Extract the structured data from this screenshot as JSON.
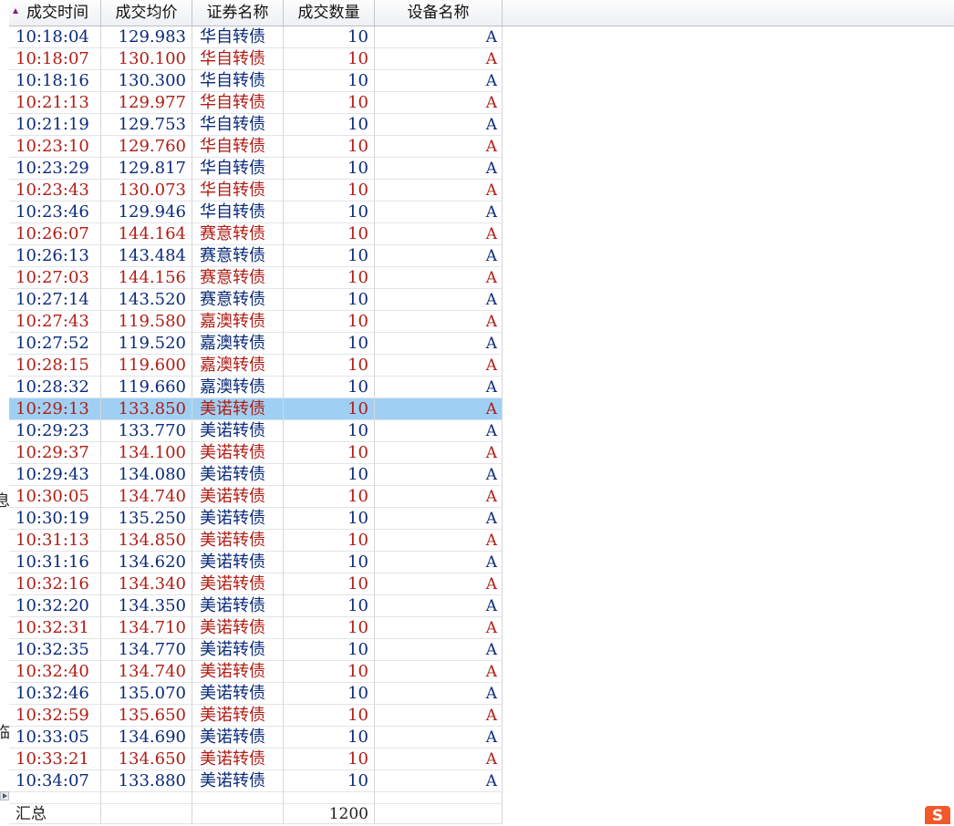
{
  "left_chars": [
    "息",
    "临"
  ],
  "columns": [
    "成交时间",
    "成交均价",
    "证券名称",
    "成交数量",
    "设备名称"
  ],
  "rows": [
    {
      "time": "10:18:04",
      "price": "129.983",
      "name": "华自转债",
      "qty": "10",
      "device": "A",
      "color": "blue"
    },
    {
      "time": "10:18:07",
      "price": "130.100",
      "name": "华自转债",
      "qty": "10",
      "device": "A",
      "color": "red"
    },
    {
      "time": "10:18:16",
      "price": "130.300",
      "name": "华自转债",
      "qty": "10",
      "device": "A",
      "color": "blue"
    },
    {
      "time": "10:21:13",
      "price": "129.977",
      "name": "华自转债",
      "qty": "10",
      "device": "A",
      "color": "red"
    },
    {
      "time": "10:21:19",
      "price": "129.753",
      "name": "华自转债",
      "qty": "10",
      "device": "A",
      "color": "blue"
    },
    {
      "time": "10:23:10",
      "price": "129.760",
      "name": "华自转债",
      "qty": "10",
      "device": "A",
      "color": "red"
    },
    {
      "time": "10:23:29",
      "price": "129.817",
      "name": "华自转债",
      "qty": "10",
      "device": "A",
      "color": "blue"
    },
    {
      "time": "10:23:43",
      "price": "130.073",
      "name": "华自转债",
      "qty": "10",
      "device": "A",
      "color": "red"
    },
    {
      "time": "10:23:46",
      "price": "129.946",
      "name": "华自转债",
      "qty": "10",
      "device": "A",
      "color": "blue"
    },
    {
      "time": "10:26:07",
      "price": "144.164",
      "name": "赛意转债",
      "qty": "10",
      "device": "A",
      "color": "red"
    },
    {
      "time": "10:26:13",
      "price": "143.484",
      "name": "赛意转债",
      "qty": "10",
      "device": "A",
      "color": "blue"
    },
    {
      "time": "10:27:03",
      "price": "144.156",
      "name": "赛意转债",
      "qty": "10",
      "device": "A",
      "color": "red"
    },
    {
      "time": "10:27:14",
      "price": "143.520",
      "name": "赛意转债",
      "qty": "10",
      "device": "A",
      "color": "blue"
    },
    {
      "time": "10:27:43",
      "price": "119.580",
      "name": "嘉澳转债",
      "qty": "10",
      "device": "A",
      "color": "red"
    },
    {
      "time": "10:27:52",
      "price": "119.520",
      "name": "嘉澳转债",
      "qty": "10",
      "device": "A",
      "color": "blue"
    },
    {
      "time": "10:28:15",
      "price": "119.600",
      "name": "嘉澳转债",
      "qty": "10",
      "device": "A",
      "color": "red"
    },
    {
      "time": "10:28:32",
      "price": "119.660",
      "name": "嘉澳转债",
      "qty": "10",
      "device": "A",
      "color": "blue"
    },
    {
      "time": "10:29:13",
      "price": "133.850",
      "name": "美诺转债",
      "qty": "10",
      "device": "A",
      "color": "red",
      "selected": true
    },
    {
      "time": "10:29:23",
      "price": "133.770",
      "name": "美诺转债",
      "qty": "10",
      "device": "A",
      "color": "blue"
    },
    {
      "time": "10:29:37",
      "price": "134.100",
      "name": "美诺转债",
      "qty": "10",
      "device": "A",
      "color": "red"
    },
    {
      "time": "10:29:43",
      "price": "134.080",
      "name": "美诺转债",
      "qty": "10",
      "device": "A",
      "color": "blue"
    },
    {
      "time": "10:30:05",
      "price": "134.740",
      "name": "美诺转债",
      "qty": "10",
      "device": "A",
      "color": "red"
    },
    {
      "time": "10:30:19",
      "price": "135.250",
      "name": "美诺转债",
      "qty": "10",
      "device": "A",
      "color": "blue"
    },
    {
      "time": "10:31:13",
      "price": "134.850",
      "name": "美诺转债",
      "qty": "10",
      "device": "A",
      "color": "red"
    },
    {
      "time": "10:31:16",
      "price": "134.620",
      "name": "美诺转债",
      "qty": "10",
      "device": "A",
      "color": "blue"
    },
    {
      "time": "10:32:16",
      "price": "134.340",
      "name": "美诺转债",
      "qty": "10",
      "device": "A",
      "color": "red"
    },
    {
      "time": "10:32:20",
      "price": "134.350",
      "name": "美诺转债",
      "qty": "10",
      "device": "A",
      "color": "blue"
    },
    {
      "time": "10:32:31",
      "price": "134.710",
      "name": "美诺转债",
      "qty": "10",
      "device": "A",
      "color": "red"
    },
    {
      "time": "10:32:35",
      "price": "134.770",
      "name": "美诺转债",
      "qty": "10",
      "device": "A",
      "color": "blue"
    },
    {
      "time": "10:32:40",
      "price": "134.740",
      "name": "美诺转债",
      "qty": "10",
      "device": "A",
      "color": "red"
    },
    {
      "time": "10:32:46",
      "price": "135.070",
      "name": "美诺转债",
      "qty": "10",
      "device": "A",
      "color": "blue"
    },
    {
      "time": "10:32:59",
      "price": "135.650",
      "name": "美诺转债",
      "qty": "10",
      "device": "A",
      "color": "red"
    },
    {
      "time": "10:33:05",
      "price": "134.690",
      "name": "美诺转债",
      "qty": "10",
      "device": "A",
      "color": "blue"
    },
    {
      "time": "10:33:21",
      "price": "134.650",
      "name": "美诺转债",
      "qty": "10",
      "device": "A",
      "color": "red"
    },
    {
      "time": "10:34:07",
      "price": "133.880",
      "name": "美诺转债",
      "qty": "10",
      "device": "A",
      "color": "blue"
    }
  ],
  "summary": {
    "label": "汇总",
    "qty": "1200"
  },
  "colors": {
    "blue": "#0a2a7a",
    "red": "#b01c14",
    "selected": "#9fd0f4"
  },
  "ime_icon": {
    "name": "sogou-ime-icon",
    "glyph": "S"
  }
}
